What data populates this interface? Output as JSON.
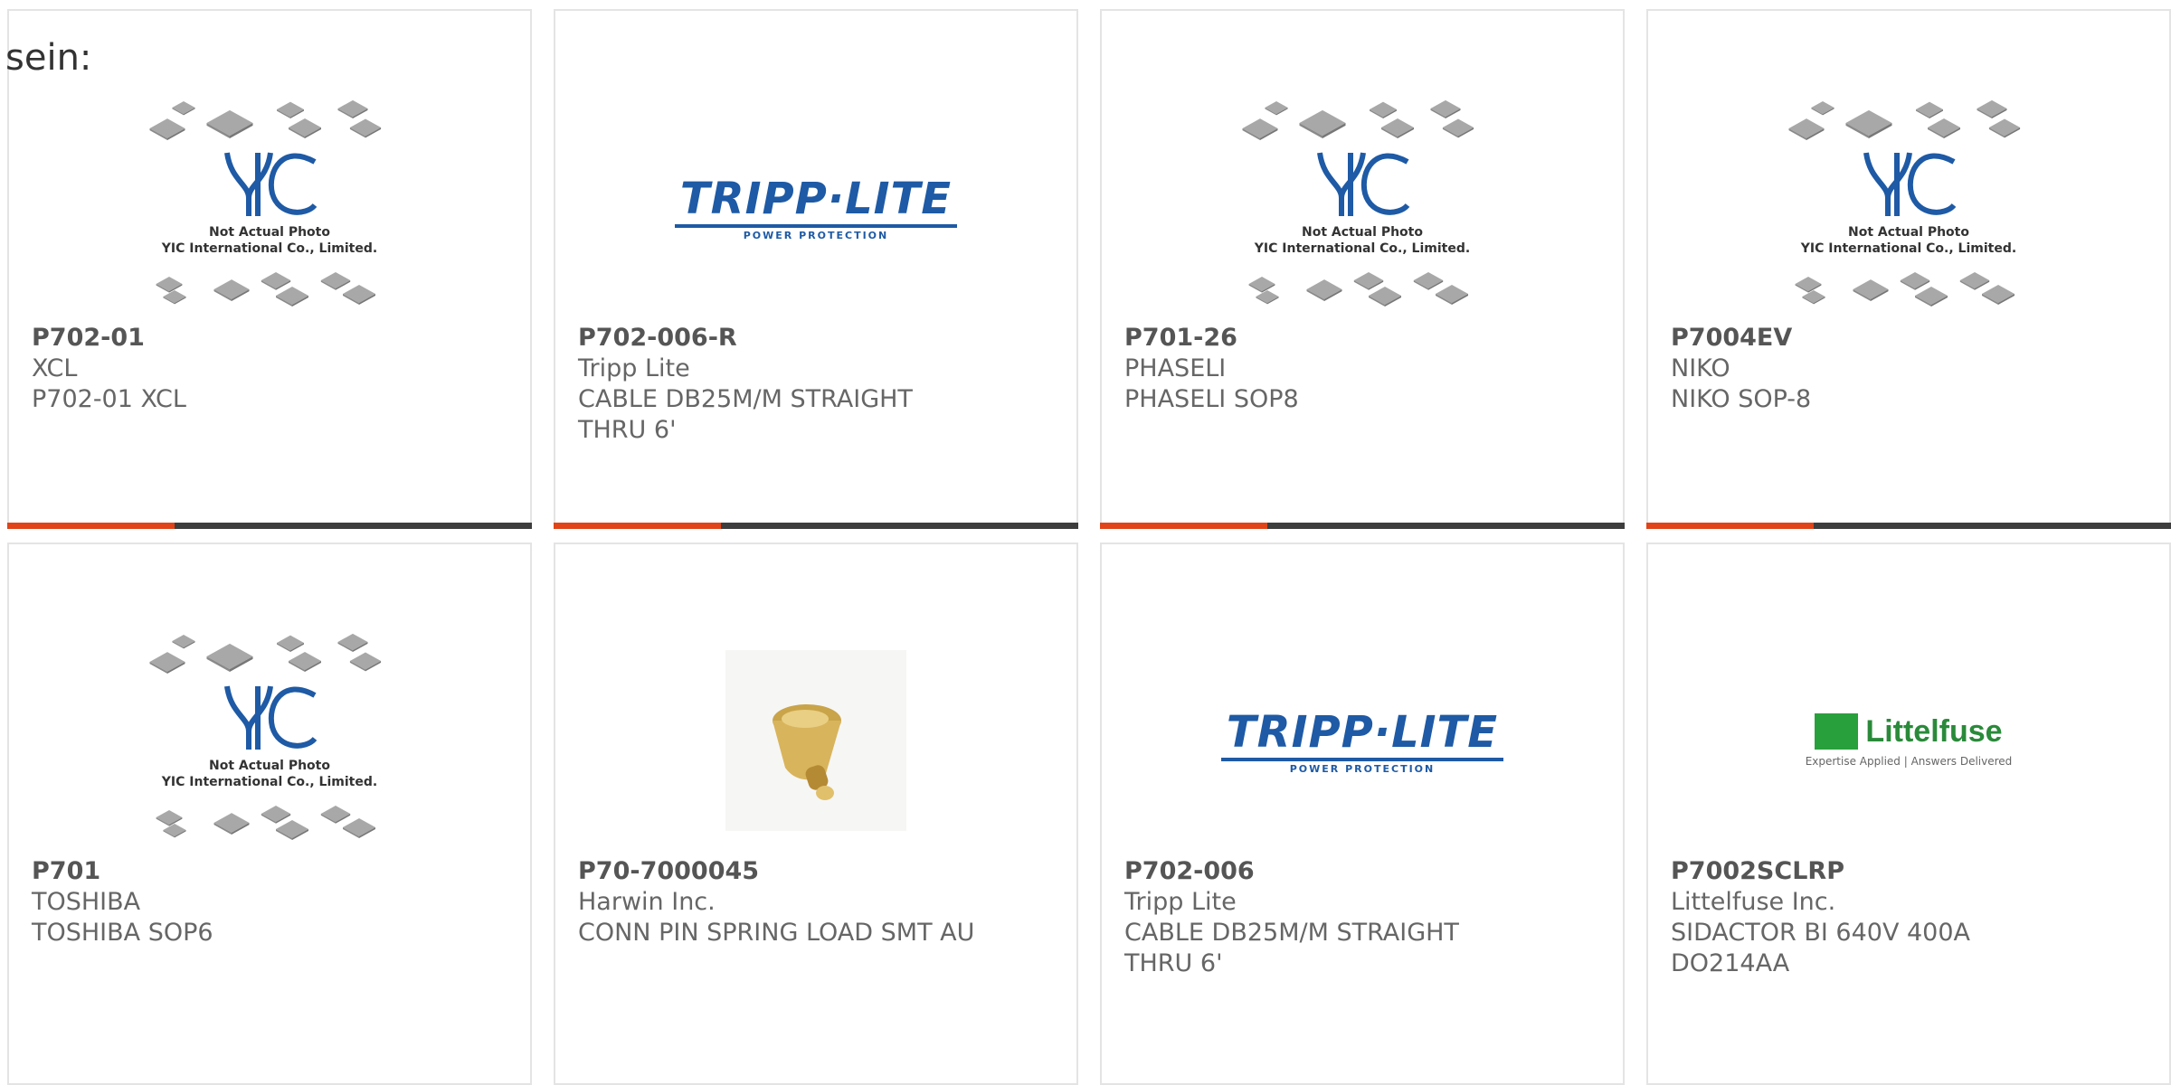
{
  "intro_text": "sein:",
  "brand": {
    "accent": "#e04418",
    "bar": "#3d3d3d",
    "tripp_blue": "#1e5aa5",
    "littelfuse_green": "#2a8a3a"
  },
  "placeholder_logo": {
    "brand": "YIC",
    "line1": "Not Actual Photo",
    "line2": "YIC International Co., Limited."
  },
  "tripp_logo": {
    "name": "TRIPP·LITE",
    "tagline": "POWER PROTECTION"
  },
  "littelfuse_logo": {
    "name": "Littelfuse",
    "tagline": "Expertise Applied | Answers Delivered"
  },
  "products": [
    {
      "part_number": "P702-01",
      "manufacturer": "XCL",
      "description": "P702-01 XCL",
      "image": "yic-placeholder"
    },
    {
      "part_number": "P702-006-R",
      "manufacturer": "Tripp Lite",
      "description": "CABLE DB25M/M STRAIGHT THRU 6'",
      "image": "tripp-lite-logo"
    },
    {
      "part_number": "P701-26",
      "manufacturer": "PHASELI",
      "description": "PHASELI SOP8",
      "image": "yic-placeholder"
    },
    {
      "part_number": "P7004EV",
      "manufacturer": "NIKO",
      "description": "NIKO SOP-8",
      "image": "yic-placeholder"
    },
    {
      "part_number": "P701",
      "manufacturer": "TOSHIBA",
      "description": "TOSHIBA SOP6",
      "image": "yic-placeholder"
    },
    {
      "part_number": "P70-7000045",
      "manufacturer": "Harwin Inc.",
      "description": "CONN PIN SPRING LOAD SMT AU",
      "image": "spring-pin-photo"
    },
    {
      "part_number": "P702-006",
      "manufacturer": "Tripp Lite",
      "description": "CABLE DB25M/M STRAIGHT THRU 6'",
      "image": "tripp-lite-logo"
    },
    {
      "part_number": "P7002SCLRP",
      "manufacturer": "Littelfuse Inc.",
      "description": "SIDACTOR BI 640V 400A DO214AA",
      "image": "littelfuse-logo"
    }
  ]
}
